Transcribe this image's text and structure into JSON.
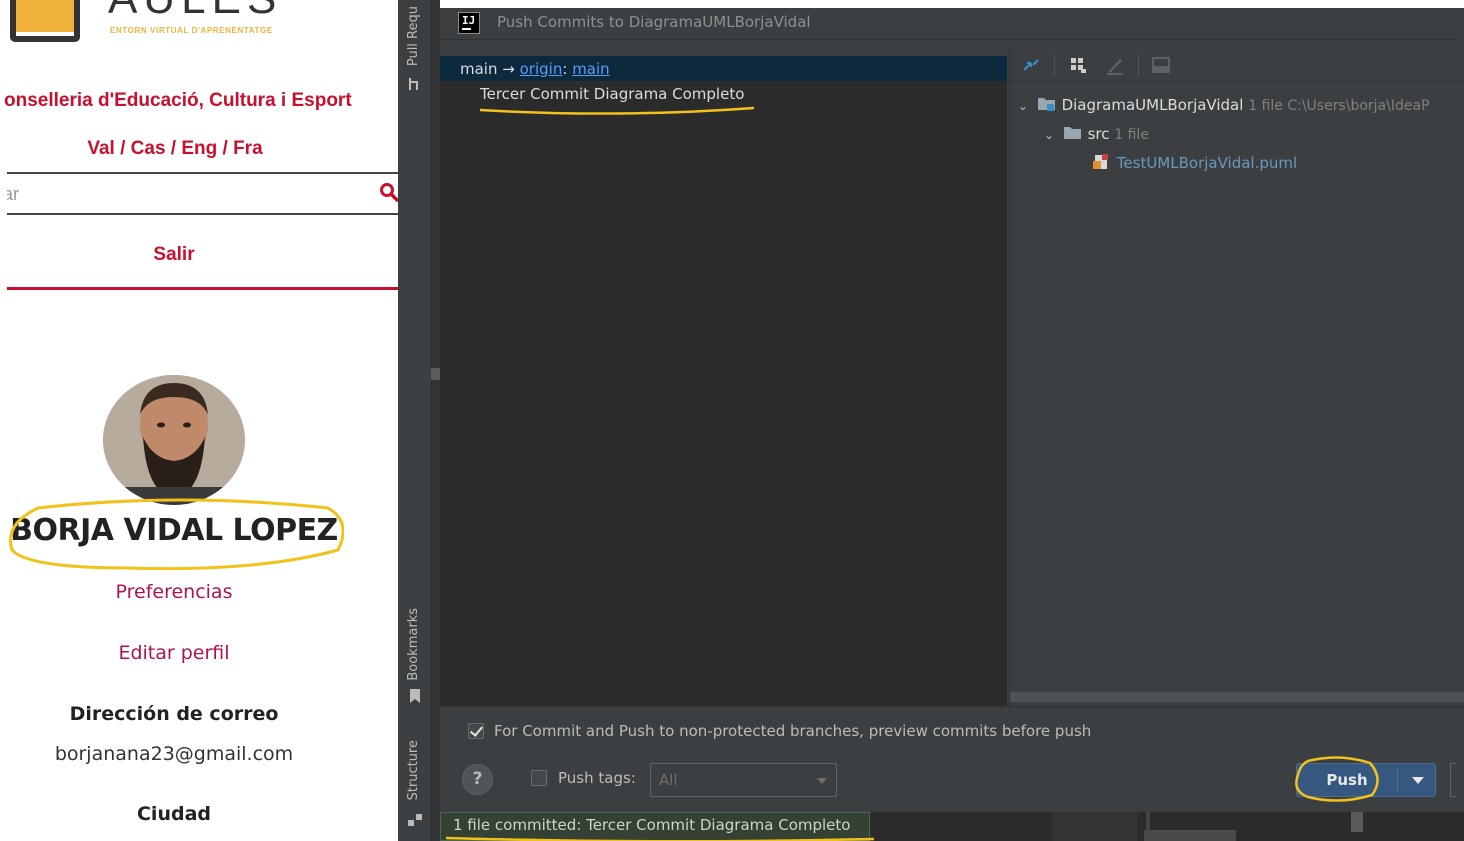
{
  "website": {
    "logo_sub": "ENTORN VIRTUAL D'APRENENTATGE",
    "conselleria": "onselleria d'Educació, Cultura i Esport",
    "languages": "Val / Cas / Eng / Fra",
    "search_value": "ar",
    "logout": "Salir",
    "user_name": "BORJA VIDAL LOPEZ",
    "preferences": "Preferencias",
    "edit_profile": "Editar perfil",
    "email_label": "Dirección de correo",
    "email_value": "borjanana23@gmail.com",
    "city_label": "Ciudad",
    "accent_color": "#c8102e"
  },
  "ide": {
    "side_tabs": [
      "Pull Requ",
      "Bookmarks",
      "Structure"
    ],
    "dialog_title": "Push Commits to DiagramaUMLBorjaVidal",
    "branch": {
      "local": "main",
      "arrow": "→",
      "remote": "origin",
      "separator": ":",
      "remote_branch": "main"
    },
    "commit_message": "Tercer Commit Diagrama Completo",
    "tree": {
      "root_name": "DiagramaUMLBorjaVidal",
      "root_info": "1 file  C:\\Users\\borja\\IdeaP",
      "folder_name": "src",
      "folder_info": "1 file",
      "file_name": "TestUMLBorjaVidal.puml"
    },
    "preview_option": "For Commit and Push to non-protected branches, preview commits before push",
    "help_label": "?",
    "push_tags_label": "Push tags:",
    "push_tags_value": "All",
    "push_button": "Push",
    "status_message": "1 file committed: Tercer Commit Diagrama Completo",
    "annotation_color": "#f2c21b"
  }
}
